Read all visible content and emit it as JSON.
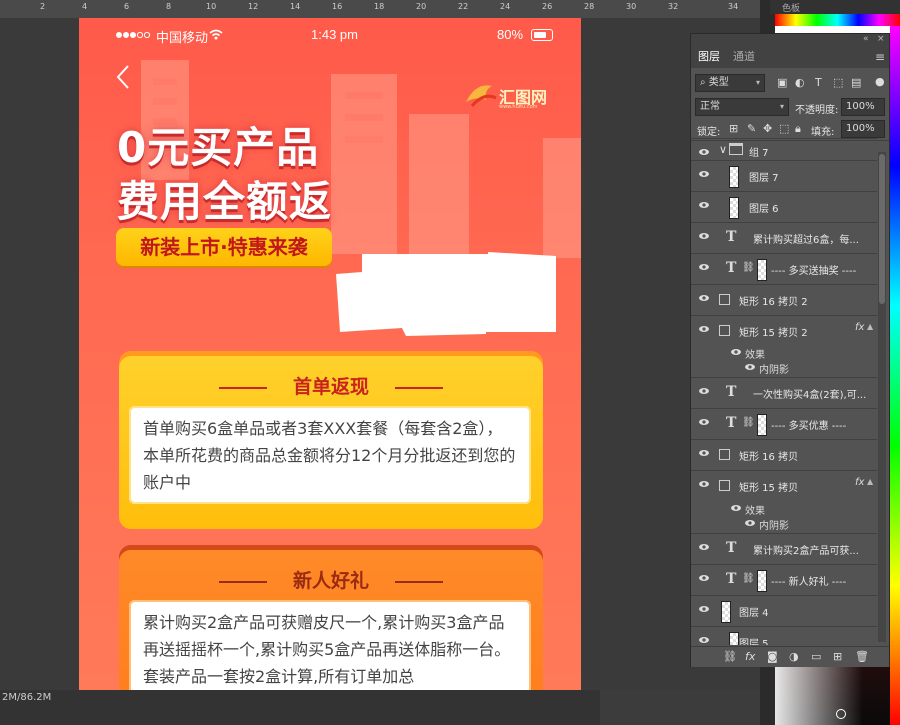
{
  "photoshop": {
    "ruler_ticks": [
      "2",
      "4",
      "6",
      "8",
      "10",
      "12",
      "14",
      "16",
      "18",
      "20",
      "22",
      "24",
      "26",
      "28",
      "30",
      "32",
      "34"
    ],
    "status_bar": "2M/86.2M",
    "dock_title": "色板"
  },
  "phone": {
    "status": {
      "carrier": "中国移动",
      "time": "1:43 pm",
      "battery": "80%"
    },
    "logo": {
      "text": "汇图网",
      "sub": "www.huitu.com"
    },
    "headline_1": "0元买产品",
    "headline_2": "费用全额返",
    "tagline": "新装上市·特惠来袭",
    "card1": {
      "title": "首单返现",
      "body": "首单购买6盒单品或者3套XXX套餐（每套含2盒），本单所花费的商品总金额将分12个月分批返还到您的账户中"
    },
    "card2": {
      "title": "新人好礼",
      "body": "累计购买2盒产品可获赠皮尺一个,累计购买3盒产品再送摇摇杯一个,累计购买5盒产品再送体脂称一台。套装产品一套按2盒计算,所有订单加总"
    }
  },
  "layers_panel": {
    "tabs": [
      "图层",
      "通道"
    ],
    "filter_label": "类型",
    "blend_mode": "正常",
    "opacity_label": "不透明度:",
    "opacity_value": "100%",
    "lock_label": "锁定:",
    "fill_label": "填充:",
    "fill_value": "100%",
    "layers": [
      {
        "name": "组 7",
        "kind": "group"
      },
      {
        "name": "图层 7",
        "kind": "pixel"
      },
      {
        "name": "图层 6",
        "kind": "pixel"
      },
      {
        "name": "累计购买超过6盒，每...",
        "kind": "text"
      },
      {
        "name": "---- 多买送抽奖 ----",
        "kind": "text-linked"
      },
      {
        "name": "矩形 16 拷贝 2",
        "kind": "shape"
      },
      {
        "name": "矩形 15 拷贝 2",
        "kind": "shape-fx"
      },
      {
        "name": "一次性购买4盒(2套),可...",
        "kind": "text"
      },
      {
        "name": "---- 多买优惠 ----",
        "kind": "text-linked"
      },
      {
        "name": "矩形 16 拷贝",
        "kind": "shape"
      },
      {
        "name": "矩形 15 拷贝",
        "kind": "shape-fx"
      },
      {
        "name": "累计购买2盒产品可获...",
        "kind": "text"
      },
      {
        "name": "---- 新人好礼 ----",
        "kind": "text-linked"
      },
      {
        "name": "图层 4",
        "kind": "pixel"
      },
      {
        "name": "图层 5",
        "kind": "pixel"
      }
    ],
    "effects_label": "效果",
    "effect_name": "内阴影",
    "fx_label": "fx"
  }
}
